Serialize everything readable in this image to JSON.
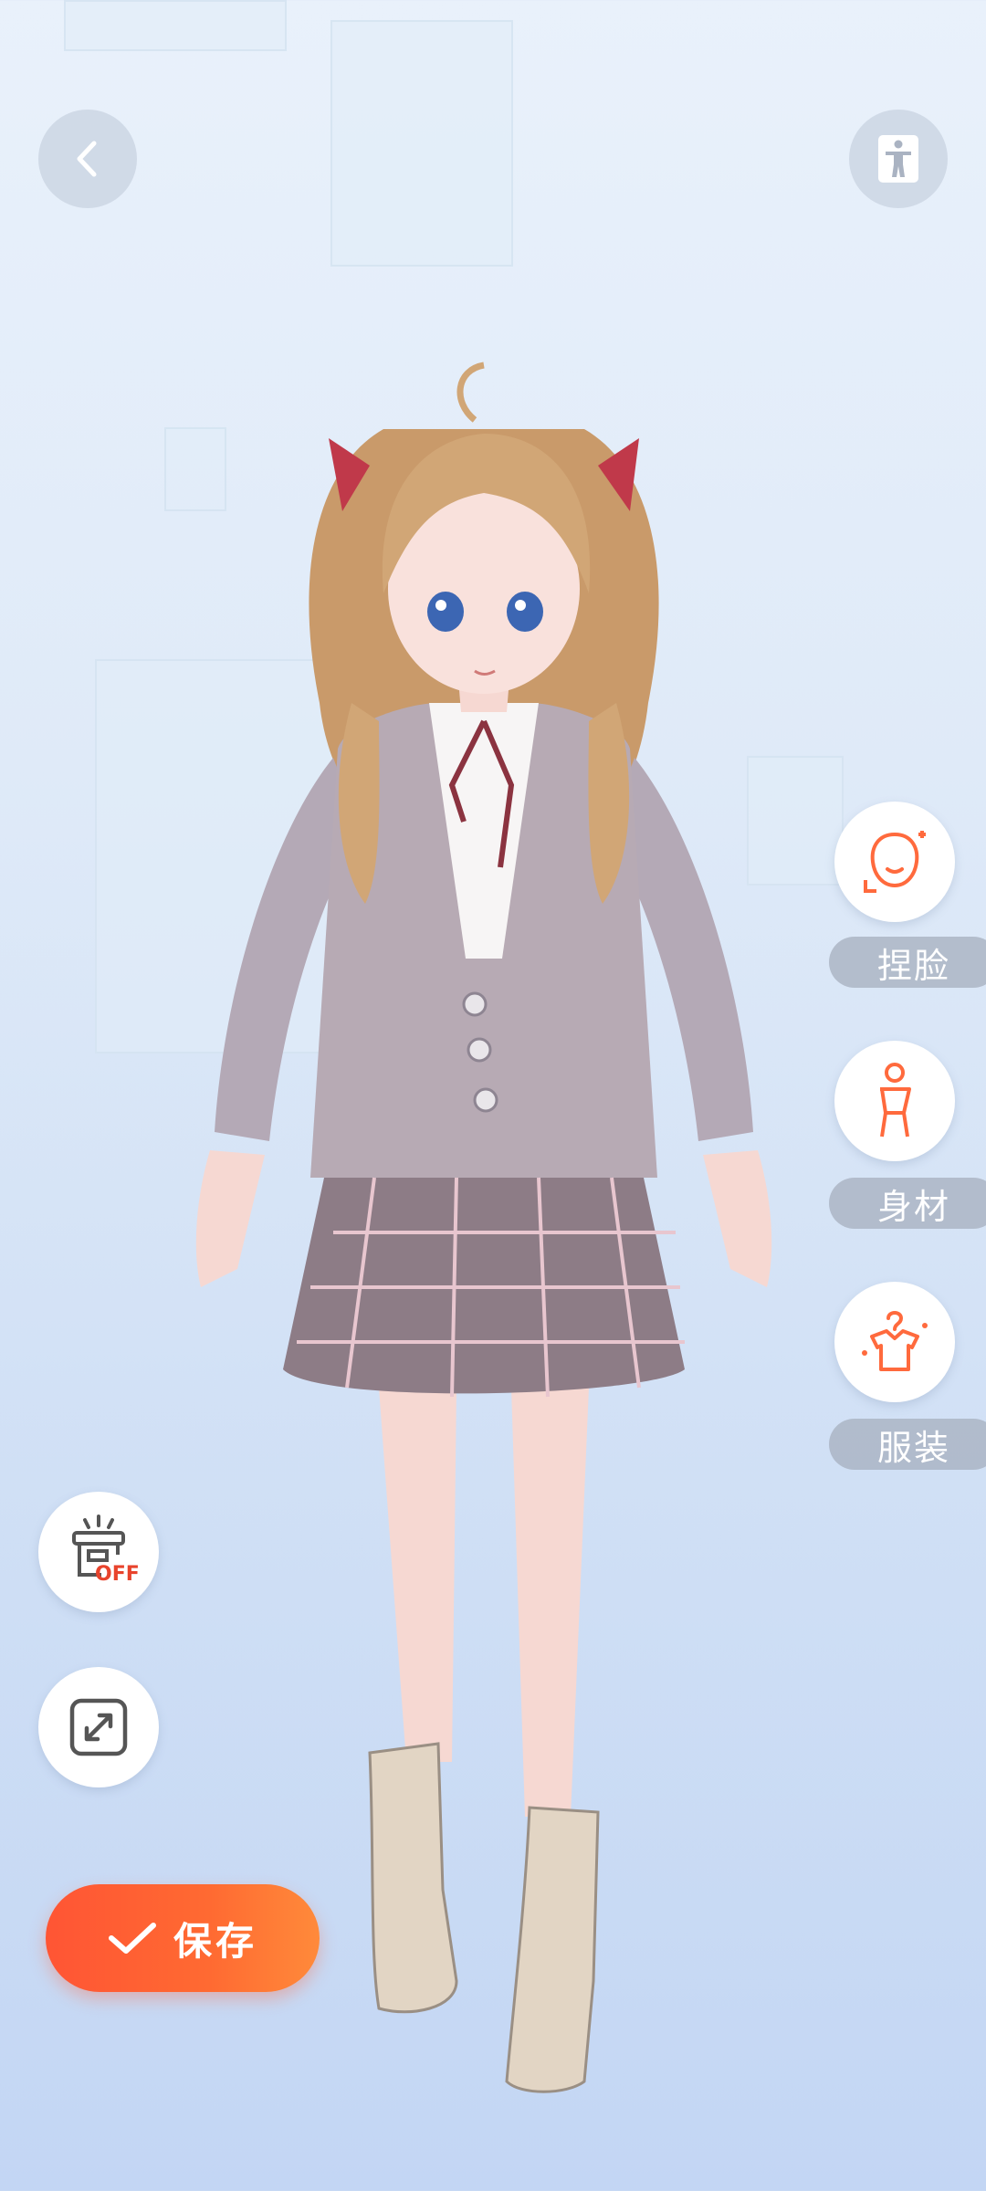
{
  "top_bar": {
    "back_icon": "chevron-left-icon",
    "pose_icon": "t-pose-figure-icon"
  },
  "side_menu": [
    {
      "id": "face",
      "label": "捏脸",
      "icon": "face-sculpt-icon"
    },
    {
      "id": "body",
      "label": "身材",
      "icon": "body-figure-icon"
    },
    {
      "id": "outfit",
      "label": "服装",
      "icon": "clothes-hanger-icon"
    }
  ],
  "left_tools": {
    "scene_toggle_badge": "OFF",
    "scene_toggle_icon": "scene-stand-off-icon",
    "fullscreen_icon": "expand-icon"
  },
  "save_button": {
    "label": "保存",
    "icon": "checkmark-icon"
  },
  "colors": {
    "accent": "#ff5b35",
    "label_bg": "#a5afbe",
    "icon_orange": "#ff6a3d"
  }
}
